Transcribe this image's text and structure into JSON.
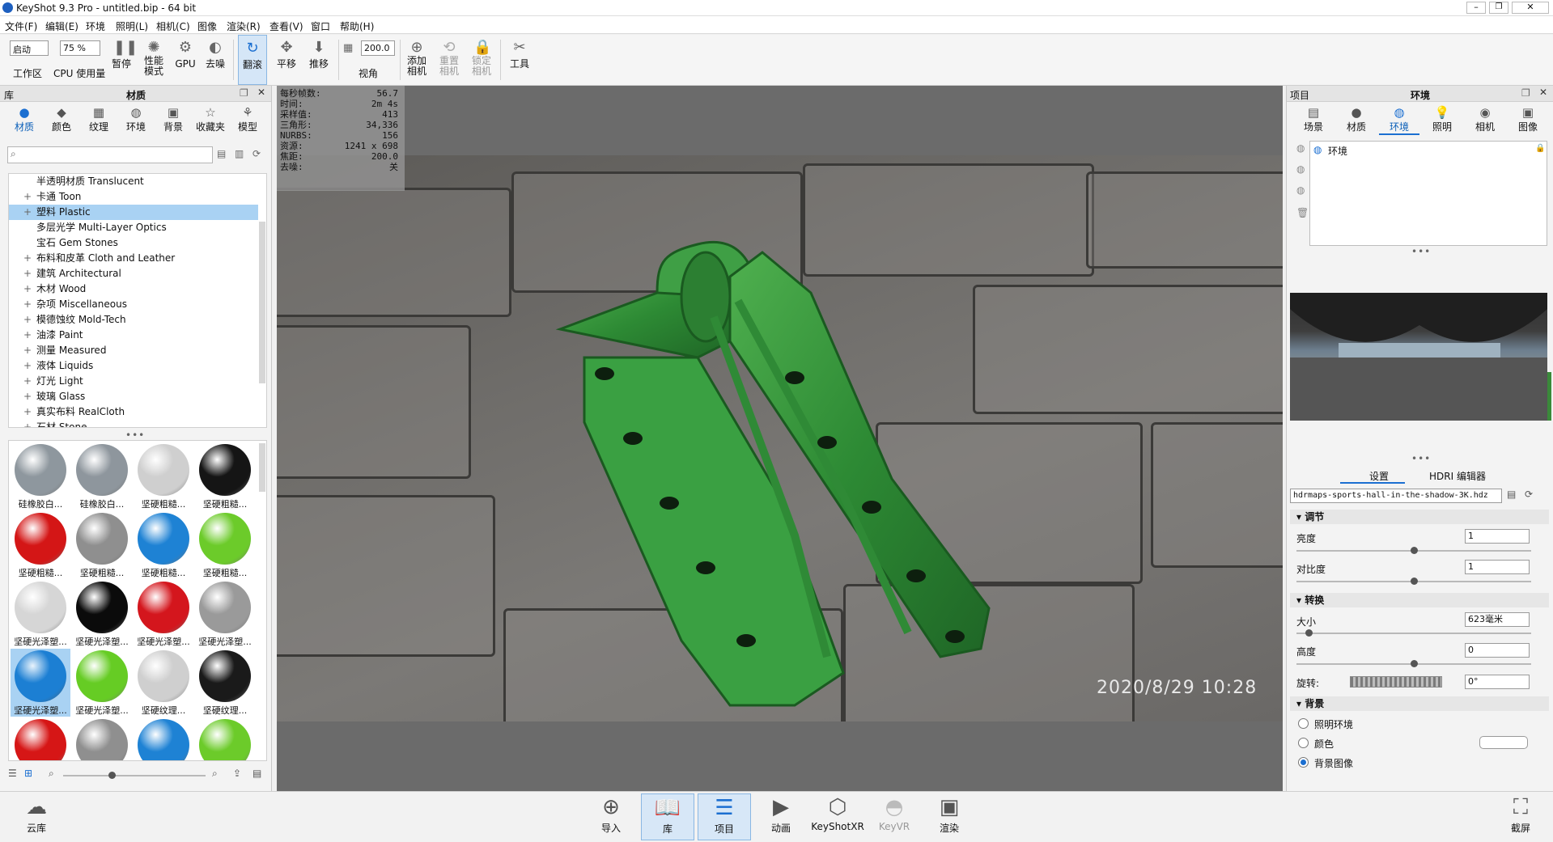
{
  "window": {
    "title": "KeyShot 9.3 Pro  - untitled.bip  - 64 bit"
  },
  "menu": [
    "文件(F)",
    "编辑(E)",
    "环境",
    "照明(L)",
    "相机(C)",
    "图像",
    "渲染(R)",
    "查看(V)",
    "窗口",
    "帮助(H)"
  ],
  "toolbar": {
    "workspace_value": "启动",
    "workspace_label": "工作区",
    "cpu_value": "75 %",
    "cpu_label": "CPU 使用量",
    "pause": "暂停",
    "perf": "性能\n模式",
    "gpu": "GPU",
    "denoise": "去噪",
    "tumble": "翻滚",
    "pan": "平移",
    "dolly": "推移",
    "fov_value": "200.0",
    "fov_label": "视角",
    "add_cam": "添加\n相机",
    "reset_cam": "重置\n相机",
    "lock_cam": "锁定\n相机",
    "tools": "工具"
  },
  "library": {
    "header_left": "库",
    "header_title": "材质",
    "tabs": [
      "材质",
      "颜色",
      "纹理",
      "环境",
      "背景",
      "收藏夹",
      "模型"
    ],
    "tree": [
      {
        "label": "半透明材质 Translucent",
        "plus": false
      },
      {
        "label": "卡通 Toon",
        "plus": true
      },
      {
        "label": "塑料 Plastic",
        "plus": true,
        "selected": true
      },
      {
        "label": "多层光学 Multi-Layer Optics",
        "plus": false
      },
      {
        "label": "宝石 Gem Stones",
        "plus": false
      },
      {
        "label": "布料和皮革 Cloth and Leather",
        "plus": true
      },
      {
        "label": "建筑 Architectural",
        "plus": true
      },
      {
        "label": "木材 Wood",
        "plus": true
      },
      {
        "label": "杂项 Miscellaneous",
        "plus": true
      },
      {
        "label": "模德蚀纹 Mold-Tech",
        "plus": true
      },
      {
        "label": "油漆 Paint",
        "plus": true
      },
      {
        "label": "测量 Measured",
        "plus": true
      },
      {
        "label": "液体 Liquids",
        "plus": true
      },
      {
        "label": "灯光 Light",
        "plus": true
      },
      {
        "label": "玻璃 Glass",
        "plus": true
      },
      {
        "label": "真实布料 RealCloth",
        "plus": true
      },
      {
        "label": "石材 Stone",
        "plus": true
      }
    ],
    "thumbs": [
      {
        "cap": "硅橡胶白...",
        "color": "#8e979e"
      },
      {
        "cap": "硅橡胶白...",
        "color": "#8e969d"
      },
      {
        "cap": "坚硬粗糙...",
        "color": "#cfcfcf"
      },
      {
        "cap": "坚硬粗糙...",
        "color": "#151515"
      },
      {
        "cap": "坚硬粗糙...",
        "color": "#d41616"
      },
      {
        "cap": "坚硬粗糙...",
        "color": "#8f8f8f"
      },
      {
        "cap": "坚硬粗糙...",
        "color": "#1e82d4"
      },
      {
        "cap": "坚硬粗糙...",
        "color": "#6ccb2a"
      },
      {
        "cap": "坚硬光泽塑...",
        "color": "#d6d6d6"
      },
      {
        "cap": "坚硬光泽塑...",
        "color": "#0b0b0b"
      },
      {
        "cap": "坚硬光泽塑...",
        "color": "#d4161d"
      },
      {
        "cap": "坚硬光泽塑...",
        "color": "#9a9a9a"
      },
      {
        "cap": "坚硬光泽塑...",
        "color": "#1c7fd3",
        "selected": true
      },
      {
        "cap": "坚硬光泽塑...",
        "color": "#66cc24"
      },
      {
        "cap": "坚硬纹理...",
        "color": "#cfcfcf"
      },
      {
        "cap": "坚硬纹理...",
        "color": "#1a1a1a"
      },
      {
        "cap": "",
        "color": "#d61616"
      },
      {
        "cap": "",
        "color": "#8f8f8f"
      },
      {
        "cap": "",
        "color": "#1e82d4"
      },
      {
        "cap": "",
        "color": "#6ccb2a"
      }
    ]
  },
  "stats": [
    {
      "k": "每秒帧数:",
      "v": "56.7"
    },
    {
      "k": "时间:",
      "v": "2m 4s"
    },
    {
      "k": "采样值:",
      "v": "413"
    },
    {
      "k": "三角形:",
      "v": "34,336"
    },
    {
      "k": "NURBS:",
      "v": "156"
    },
    {
      "k": "资源:",
      "v": "1241 x 698"
    },
    {
      "k": "焦距:",
      "v": "200.0"
    },
    {
      "k": "去噪:",
      "v": "关"
    }
  ],
  "viewport": {
    "timestamp": "2020/8/29  10:28"
  },
  "project": {
    "header_left": "项目",
    "header_title": "环境",
    "tabs": [
      "场景",
      "材质",
      "环境",
      "照明",
      "相机",
      "图像"
    ],
    "env_item": "环境",
    "subtabs": [
      "设置",
      "HDRI 编辑器"
    ],
    "hdri_file": "hdrmaps-sports-hall-in-the-shadow-3K.hdz",
    "sections": {
      "adjust": "调节",
      "transform": "转换",
      "background": "背景"
    },
    "brightness_label": "亮度",
    "brightness": "1",
    "brightness_level": 0.5,
    "contrast_label": "对比度",
    "contrast": "1",
    "contrast_level": 0.5,
    "size_label": "大小",
    "size": "623毫米",
    "size_level": 0.05,
    "height_label": "高度",
    "height": "0",
    "height_level": 0.5,
    "rotation_label": "旋转:",
    "rotation": "0°",
    "bg_options": [
      "照明环境",
      "颜色",
      "背景图像"
    ],
    "bg_selected": 2
  },
  "bottom": {
    "cloud": "云库",
    "screenshot": "截屏",
    "items": [
      "导入",
      "库",
      "项目",
      "动画",
      "KeyShotXR",
      "KeyVR",
      "渲染"
    ]
  }
}
